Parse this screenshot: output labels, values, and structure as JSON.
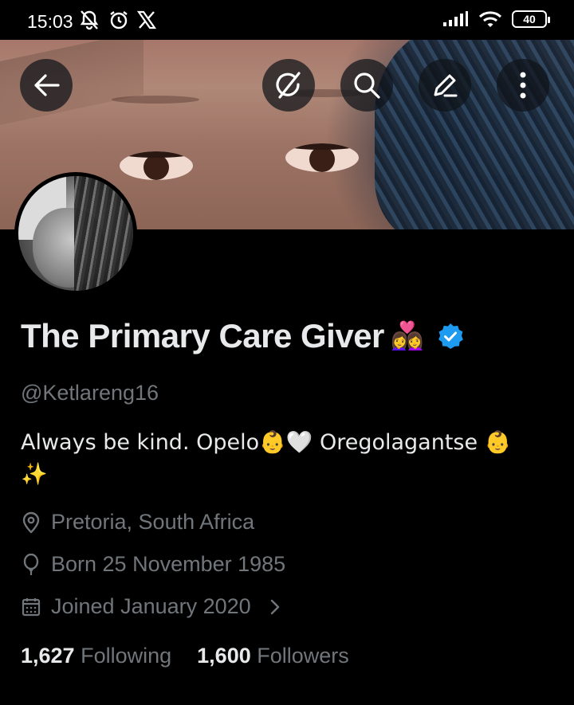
{
  "status_bar": {
    "time": "15:03",
    "battery": "40",
    "icons": [
      "mute-bell-icon",
      "alarm-icon",
      "x-logo-icon",
      "signal-icon",
      "wifi-icon",
      "battery-icon"
    ]
  },
  "header": {
    "buttons": [
      "back-arrow-icon",
      "grok-icon",
      "search-icon",
      "edit-icon",
      "more-vertical-icon"
    ]
  },
  "profile": {
    "name": "The Primary Care Giver",
    "name_emoji": "👩‍❤️‍👩",
    "verified": true,
    "handle": "@Ketlareng16",
    "bio_line1": "Always be kind.  Opelo👶🤍 Oregolagantse 👶",
    "bio_line2": "✨",
    "location": "Pretoria, South Africa",
    "birthday": "Born 25 November 1985",
    "joined": "Joined January 2020",
    "following_count": "1,627",
    "following_label": "Following",
    "followers_count": "1,600",
    "followers_label": "Followers"
  },
  "colors": {
    "background": "#000000",
    "primary_text": "#e7e9ea",
    "secondary_text": "#71767b",
    "verified_blue": "#1d9bf0"
  }
}
